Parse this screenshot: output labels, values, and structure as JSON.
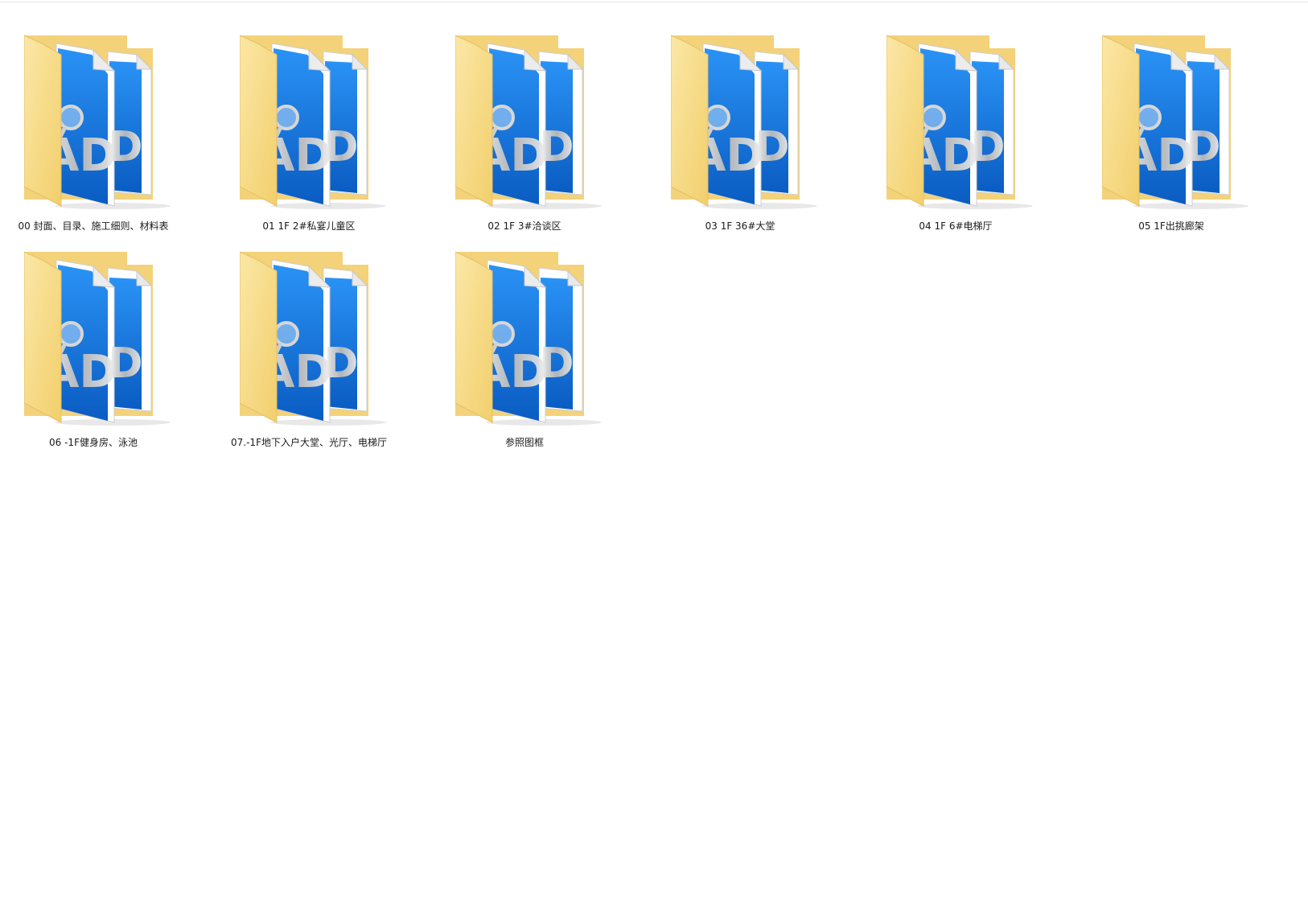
{
  "folders": [
    {
      "name": "00 封面、目录、施工细则、材料表"
    },
    {
      "name": "01 1F 2#私宴儿童区"
    },
    {
      "name": "02 1F 3#洽谈区"
    },
    {
      "name": "03 1F 36#大堂"
    },
    {
      "name": "04 1F 6#电梯厅"
    },
    {
      "name": "05 1F出挑廊架"
    },
    {
      "name": "06 -1F健身房、泳池"
    },
    {
      "name": "07.-1F地下入户大堂、光厅、电梯厅"
    },
    {
      "name": "参照图框"
    }
  ],
  "icon": {
    "type": "folder-with-cad-files-icon",
    "folder_color": "#F7DA84",
    "folder_back_color": "#F0C75E",
    "doc_blue": "#1A7FE8",
    "doc_blue_dark": "#0B5FC4",
    "cad_text": "CAD"
  }
}
